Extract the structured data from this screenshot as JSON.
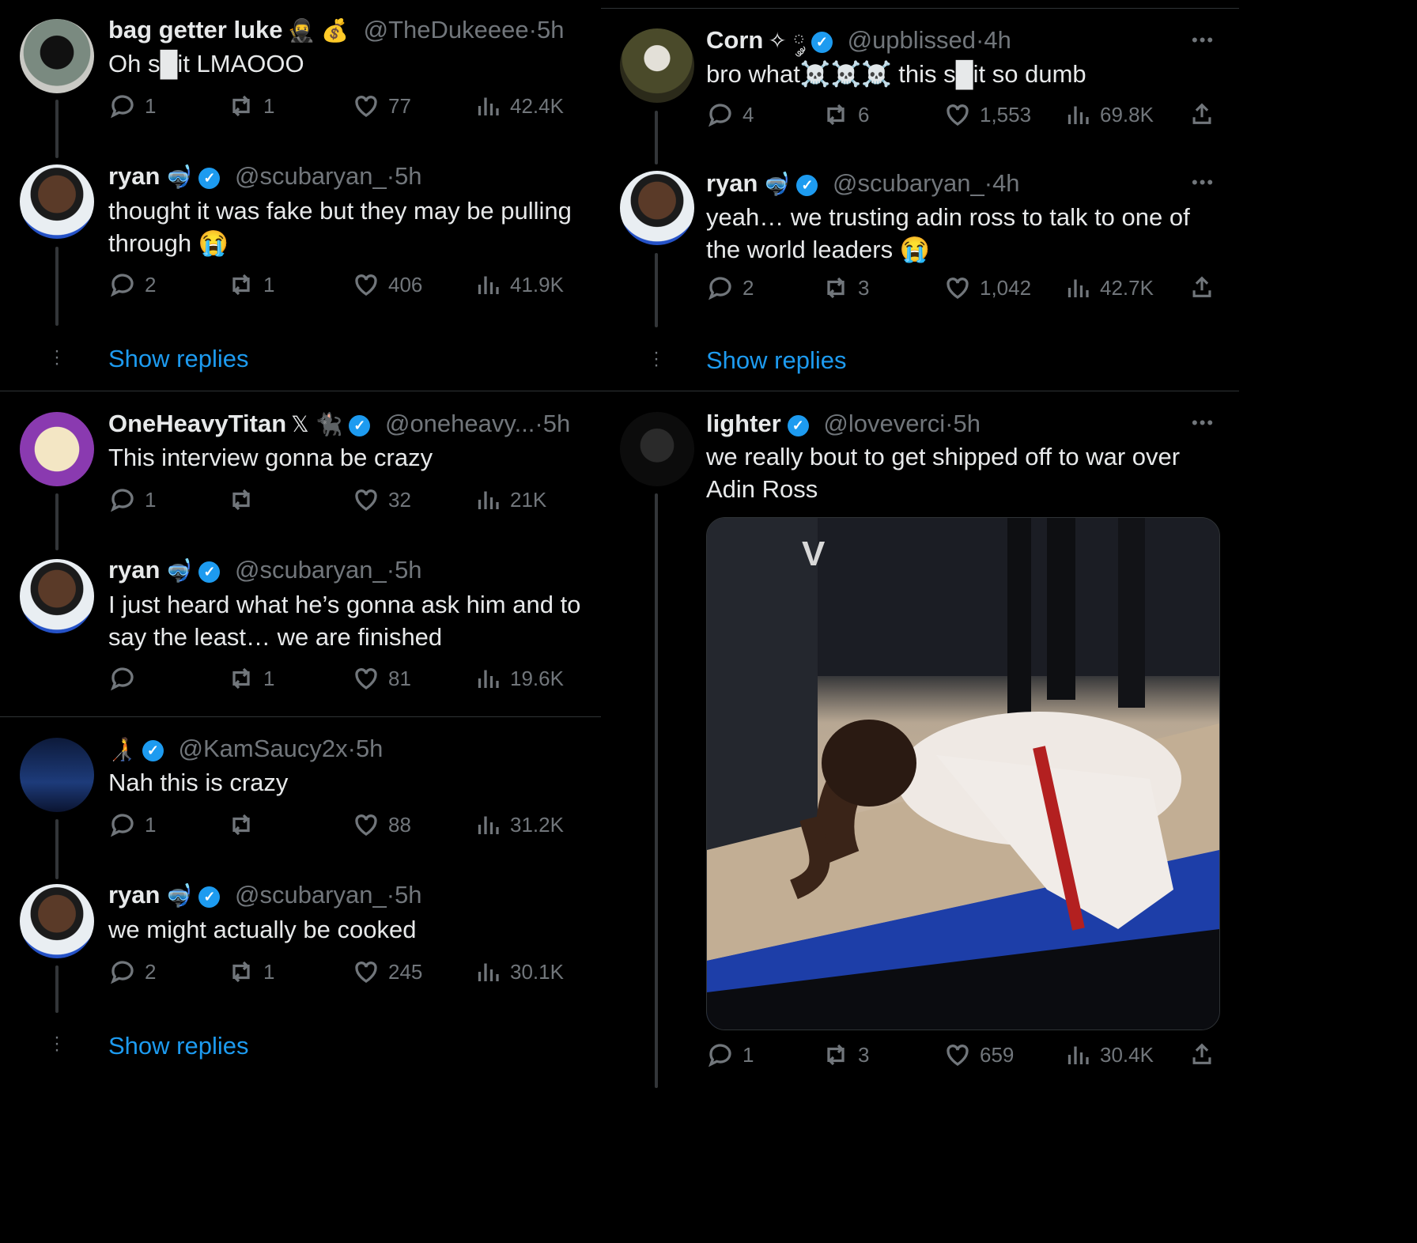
{
  "left": {
    "thread1": [
      {
        "name": "bag getter luke",
        "emoji": "🥷 💰",
        "handle": "@TheDukeeee",
        "time": "5h",
        "text": "Oh s█it LMAOOO",
        "verified": false,
        "replies": "1",
        "retweets": "1",
        "likes": "77",
        "views": "42.4K"
      },
      {
        "name": "ryan",
        "emoji": "🤿",
        "handle": "@scubaryan_",
        "time": "5h",
        "text": "thought it was fake but they may be pulling through 😭",
        "verified": true,
        "replies": "2",
        "retweets": "1",
        "likes": "406",
        "views": "41.9K"
      }
    ],
    "thread2": [
      {
        "name": "OneHeavyTitan",
        "emoji": "𝕏 🐈‍⬛",
        "handle": "@oneheavy...",
        "time": "5h",
        "text": "This interview gonna be crazy",
        "verified": true,
        "replies": "1",
        "retweets": "",
        "likes": "32",
        "views": "21K"
      },
      {
        "name": "ryan",
        "emoji": "🤿",
        "handle": "@scubaryan_",
        "time": "5h",
        "text": "I just heard what he’s gonna ask him and to say the least… we are finished",
        "verified": true,
        "replies": "",
        "retweets": "1",
        "likes": "81",
        "views": "19.6K"
      }
    ],
    "thread3": [
      {
        "name": "",
        "emoji": "🧑‍🦯",
        "handle": "@KamSaucy2x",
        "time": "5h",
        "text": "Nah this is crazy",
        "verified": true,
        "replies": "1",
        "retweets": "",
        "likes": "88",
        "views": "31.2K"
      },
      {
        "name": "ryan",
        "emoji": "🤿",
        "handle": "@scubaryan_",
        "time": "5h",
        "text": "we might actually be cooked",
        "verified": true,
        "replies": "2",
        "retweets": "1",
        "likes": "245",
        "views": "30.1K"
      }
    ]
  },
  "right": {
    "thread1": [
      {
        "name": "Corn",
        "emoji": "✧ ༘",
        "handle": "@upblissed",
        "time": "4h",
        "text": "bro what☠️☠️☠️ this s█it so dumb",
        "verified": true,
        "replies": "4",
        "retweets": "6",
        "likes": "1,553",
        "views": "69.8K"
      },
      {
        "name": "ryan",
        "emoji": "🤿",
        "handle": "@scubaryan_",
        "time": "4h",
        "text": "yeah… we trusting adin ross to talk to one of the world leaders 😭",
        "verified": true,
        "replies": "2",
        "retweets": "3",
        "likes": "1,042",
        "views": "42.7K"
      }
    ],
    "thread2": [
      {
        "name": "lighter",
        "emoji": "",
        "handle": "@loveverci",
        "time": "5h",
        "text": "we really bout to get shipped off to war over Adin Ross",
        "verified": true,
        "replies": "1",
        "retweets": "3",
        "likes": "659",
        "views": "30.4K"
      }
    ]
  },
  "ui": {
    "show_replies": "Show replies",
    "dot": "·",
    "verified_mark": "✓",
    "more": "•••"
  }
}
